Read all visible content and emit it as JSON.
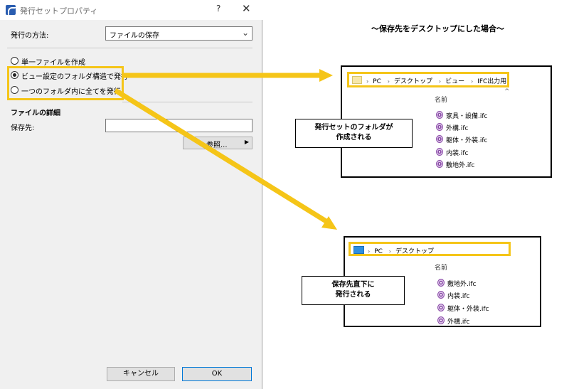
{
  "dialog": {
    "title": "発行セットプロパティ",
    "help": "?",
    "close": "✕",
    "method_label": "発行の方法:",
    "method_value": "ファイルの保存",
    "options": [
      {
        "label": "単一ファイルを作成",
        "checked": false
      },
      {
        "label": "ビュー設定のフォルダ構造で発行",
        "checked": true
      },
      {
        "label": "一つのフォルダ内に全てを発行",
        "checked": false
      }
    ],
    "details_title": "ファイルの詳細",
    "save_to_label": "保存先:",
    "save_to_value": "",
    "browse_label": "参照...",
    "cancel_label": "キャンセル",
    "ok_label": "OK"
  },
  "heading": "〜保存先をデスクトップにした場合〜",
  "explorer1": {
    "crumbs": [
      "PC",
      "デスクトップ",
      "ビュー",
      "IFC出力用"
    ],
    "column_name": "名前",
    "files": [
      "家具・設備.ifc",
      "外構.ifc",
      "躯体・外装.ifc",
      "内装.ifc",
      "敷地外.ifc"
    ]
  },
  "explorer2": {
    "crumbs": [
      "PC",
      "デスクトップ"
    ],
    "column_name": "名前",
    "files": [
      "敷地外.ifc",
      "内装.ifc",
      "躯体・外装.ifc",
      "外構.ifc"
    ]
  },
  "callout1": {
    "line1": "発行セットのフォルダが",
    "line2": "作成される"
  },
  "callout2": {
    "line1": "保存先直下に",
    "line2": "発行される"
  },
  "colors": {
    "highlight": "#f5c518",
    "dialog_bg": "#f0f0f0",
    "ok_border": "#0078d7"
  }
}
